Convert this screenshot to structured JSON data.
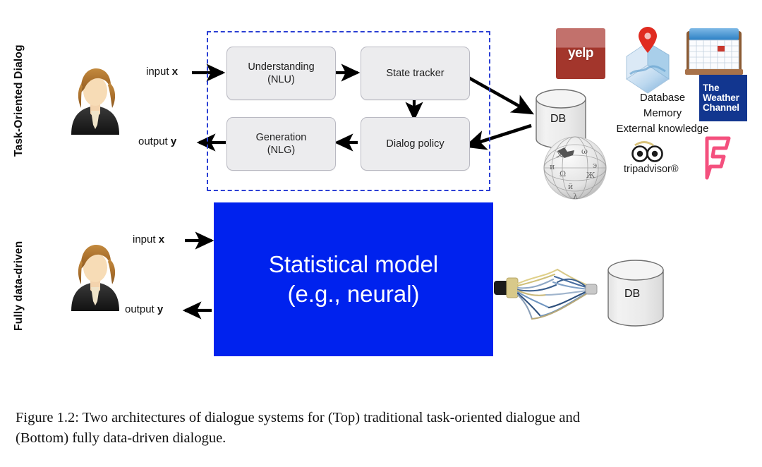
{
  "figure": {
    "caption_line1": "Figure 1.2: Two architectures of dialogue systems for (Top) traditional task-oriented dialogue and",
    "caption_line2": "(Bottom) fully data-driven dialogue."
  },
  "colors": {
    "dashed_border": "#2b3fd4",
    "blue_box": "#0022ee",
    "module_fill": "#ececee",
    "module_border": "#b9b9c2",
    "arrow": "#000000",
    "yelp_red": "#a3362c",
    "weather_blue": "#12368f",
    "foursquare_pink": "#f4507e"
  },
  "top_row": {
    "row_label": "Task-Oriented Dialog",
    "avatar_name": "woman-user-avatar",
    "input_label_prefix": "input ",
    "input_label_var": "x",
    "output_label_prefix": "output ",
    "output_label_var": "y",
    "modules": [
      {
        "id": "nlu",
        "line1": "Understanding",
        "line2": "(NLU)"
      },
      {
        "id": "state-tracker",
        "line1": "State tracker",
        "line2": ""
      },
      {
        "id": "dialog-policy",
        "line1": "Dialog policy",
        "line2": ""
      },
      {
        "id": "nlg",
        "line1": "Generation",
        "line2": "(NLG)"
      }
    ],
    "database": {
      "label": "DB"
    },
    "knowledge": {
      "line1": "Database",
      "line2": "Memory",
      "line3": "External knowledge"
    },
    "logos": [
      {
        "id": "yelp",
        "name": "yelp-logo",
        "text": "yelp"
      },
      {
        "id": "maps",
        "name": "maps-pin-logo",
        "text": ""
      },
      {
        "id": "calendar",
        "name": "calendar-logo",
        "text": ""
      },
      {
        "id": "weather",
        "name": "weather-channel-logo",
        "text": "The Weather Channel",
        "l1": "The",
        "l2": "Weather",
        "l3": "Channel"
      },
      {
        "id": "wikipedia",
        "name": "wikipedia-globe-logo",
        "text": ""
      },
      {
        "id": "tripadvisor",
        "name": "tripadvisor-logo",
        "text": "tripadvisor®"
      },
      {
        "id": "foursquare",
        "name": "foursquare-logo",
        "text": ""
      }
    ]
  },
  "bottom_row": {
    "row_label": "Fully data-driven",
    "avatar_name": "woman-user-avatar",
    "input_label_prefix": "input ",
    "input_label_var": "x",
    "output_label_prefix": "output ",
    "output_label_var": "y",
    "model_box": {
      "line1": "Statistical model",
      "line2": "(e.g., neural)"
    },
    "database": {
      "label": "DB"
    },
    "cable_name": "frayed-ethernet-cable"
  }
}
